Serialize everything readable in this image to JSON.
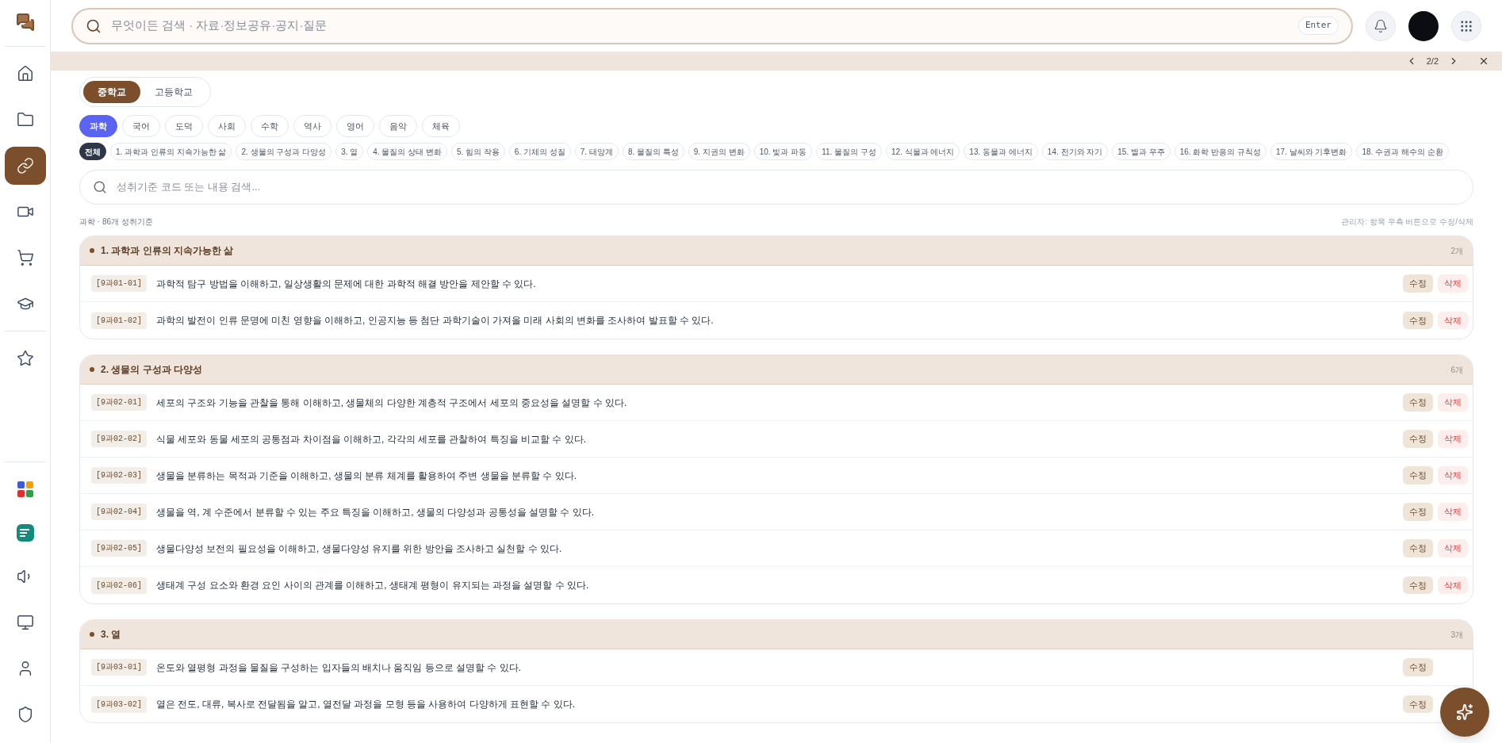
{
  "search": {
    "placeholder": "무엇이든 검색 · 자료·정보공유·공지·질문",
    "key_hint": "Enter"
  },
  "notice": {
    "pager": "2/2"
  },
  "school_tabs": [
    {
      "label": "중학교",
      "selected": true
    },
    {
      "label": "고등학교",
      "selected": false
    }
  ],
  "subjects": [
    {
      "label": "과학",
      "selected": true
    },
    {
      "label": "국어",
      "selected": false
    },
    {
      "label": "도덕",
      "selected": false
    },
    {
      "label": "사회",
      "selected": false
    },
    {
      "label": "수학",
      "selected": false
    },
    {
      "label": "역사",
      "selected": false
    },
    {
      "label": "영어",
      "selected": false
    },
    {
      "label": "음악",
      "selected": false
    },
    {
      "label": "체육",
      "selected": false
    }
  ],
  "units": [
    {
      "label": "전체",
      "selected": true
    },
    {
      "label": "1. 과학과 인류의 지속가능한 삶",
      "selected": false
    },
    {
      "label": "2. 생물의 구성과 다양성",
      "selected": false
    },
    {
      "label": "3. 열",
      "selected": false
    },
    {
      "label": "4. 물질의 상태 변화",
      "selected": false
    },
    {
      "label": "5. 힘의 작용",
      "selected": false
    },
    {
      "label": "6. 기체의 성질",
      "selected": false
    },
    {
      "label": "7. 태양계",
      "selected": false
    },
    {
      "label": "8. 물질의 특성",
      "selected": false
    },
    {
      "label": "9. 지권의 변화",
      "selected": false
    },
    {
      "label": "10. 빛과 파동",
      "selected": false
    },
    {
      "label": "11. 물질의 구성",
      "selected": false
    },
    {
      "label": "12. 식물과 에너지",
      "selected": false
    },
    {
      "label": "13. 동물과 에너지",
      "selected": false
    },
    {
      "label": "14. 전기와 자기",
      "selected": false
    },
    {
      "label": "15. 별과 우주",
      "selected": false
    },
    {
      "label": "16. 화학 반응의 규칙성",
      "selected": false
    },
    {
      "label": "17. 날씨와 기후변화",
      "selected": false
    },
    {
      "label": "18. 수권과 해수의 순환",
      "selected": false
    }
  ],
  "standard_search": {
    "placeholder": "성취기준 코드 또는 내용 검색..."
  },
  "summary": "과학 · 86개 성취기준",
  "admin_hint": "관리자: 항목 우측 버튼으로 수정/삭제",
  "sections": [
    {
      "title": "1. 과학과 인류의 지속가능한 삶",
      "count": "2개",
      "rows": [
        {
          "code": "[9과01-01]",
          "text": "과학적 탐구 방법을 이해하고, 일상생활의 문제에 대한 과학적 해결 방안을 제안할 수 있다.",
          "actions": [
            "수정",
            "삭제"
          ]
        },
        {
          "code": "[9과01-02]",
          "text": "과학의 발전이 인류 문명에 미친 영향을 이해하고, 인공지능 등 첨단 과학기술이 가져올 미래 사회의 변화를 조사하여 발표할 수 있다.",
          "actions": [
            "수정",
            "삭제"
          ]
        }
      ]
    },
    {
      "title": "2. 생물의 구성과 다양성",
      "count": "6개",
      "rows": [
        {
          "code": "[9과02-01]",
          "text": "세포의 구조와 기능을 관찰을 통해 이해하고, 생물체의 다양한 계층적 구조에서 세포의 중요성을 설명할 수 있다.",
          "actions": [
            "수정",
            "삭제"
          ]
        },
        {
          "code": "[9과02-02]",
          "text": "식물 세포와 동물 세포의 공통점과 차이점을 이해하고, 각각의 세포를 관찰하여 특징을 비교할 수 있다.",
          "actions": [
            "수정",
            "삭제"
          ]
        },
        {
          "code": "[9과02-03]",
          "text": "생물을 분류하는 목적과 기준을 이해하고, 생물의 분류 체계를 활용하여 주변 생물을 분류할 수 있다.",
          "actions": [
            "수정",
            "삭제"
          ]
        },
        {
          "code": "[9과02-04]",
          "text": "생물을 역, 계 수준에서 분류할 수 있는 주요 특징을 이해하고, 생물의 다양성과 공통성을 설명할 수 있다.",
          "actions": [
            "수정",
            "삭제"
          ]
        },
        {
          "code": "[9과02-05]",
          "text": "생물다양성 보전의 필요성을 이해하고, 생물다양성 유지를 위한 방안을 조사하고 실천할 수 있다.",
          "actions": [
            "수정",
            "삭제"
          ]
        },
        {
          "code": "[9과02-06]",
          "text": "생태계 구성 요소와 환경 요인 사이의 관계를 이해하고, 생태계 평형이 유지되는 과정을 설명할 수 있다.",
          "actions": [
            "수정",
            "삭제"
          ]
        }
      ]
    },
    {
      "title": "3. 열",
      "count": "3개",
      "rows": [
        {
          "code": "[9과03-01]",
          "text": "온도와 열평형 과정을 물질을 구성하는 입자들의 배치나 움직임 등으로 설명할 수 있다.",
          "actions": [
            "수정"
          ]
        },
        {
          "code": "[9과03-02]",
          "text": "열은 전도, 대류, 복사로 전달됨을 알고, 열전달 과정을 모형 등을 사용하여 다양하게 표현할 수 있다.",
          "actions": [
            "수정"
          ]
        }
      ]
    }
  ]
}
